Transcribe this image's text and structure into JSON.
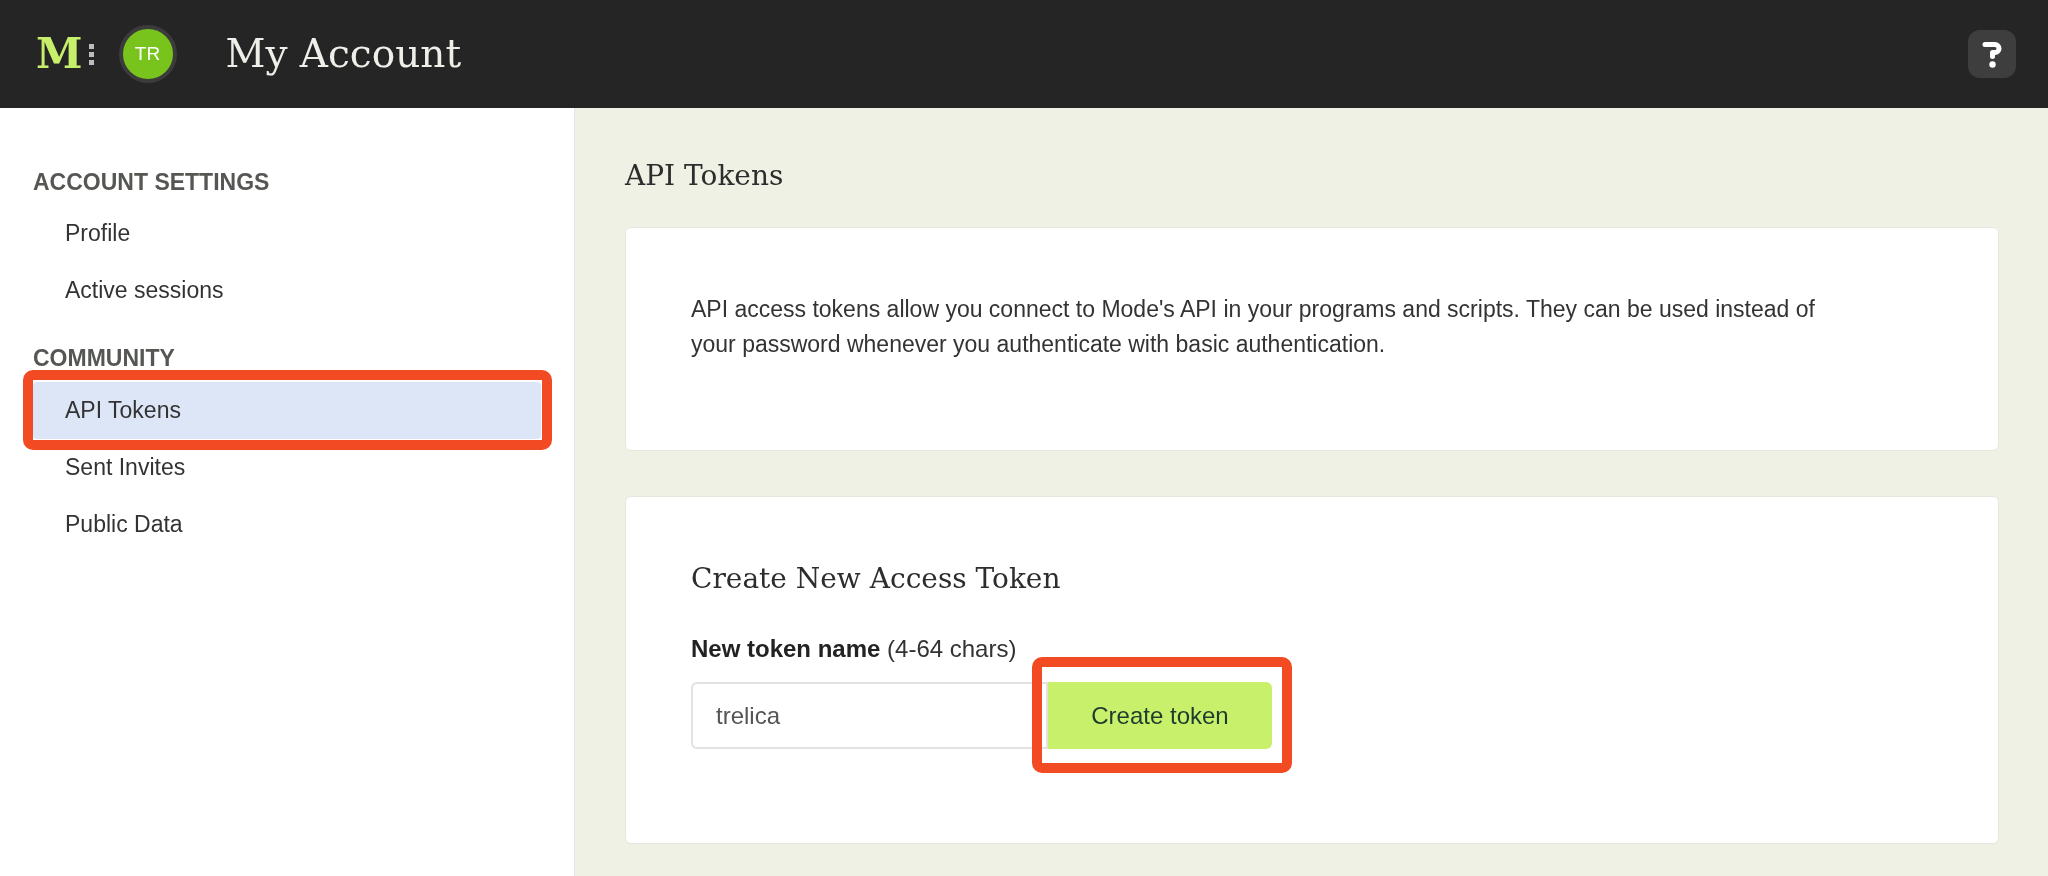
{
  "header": {
    "logo": "M",
    "avatar": "TR",
    "title": "My Account"
  },
  "sidebar": {
    "sections": [
      {
        "heading": "ACCOUNT SETTINGS",
        "items": [
          {
            "label": "Profile",
            "selected": false,
            "highlighted": false
          },
          {
            "label": "Active sessions",
            "selected": false,
            "highlighted": false
          }
        ]
      },
      {
        "heading": "COMMUNITY",
        "items": [
          {
            "label": "API Tokens",
            "selected": true,
            "highlighted": true
          },
          {
            "label": "Sent Invites",
            "selected": false,
            "highlighted": false
          },
          {
            "label": "Public Data",
            "selected": false,
            "highlighted": false
          }
        ]
      }
    ]
  },
  "main": {
    "title": "API Tokens",
    "intro": "API access tokens allow you connect to Mode's API in your programs and scripts. They can be used instead of your password whenever you authenticate with basic authentication.",
    "create_card": {
      "title": "Create New Access Token",
      "field": {
        "label": "**New token name** (4-64 chars)",
        "value": "trelica"
      },
      "button": {
        "label": "Create token",
        "highlighted": true
      }
    }
  }
}
